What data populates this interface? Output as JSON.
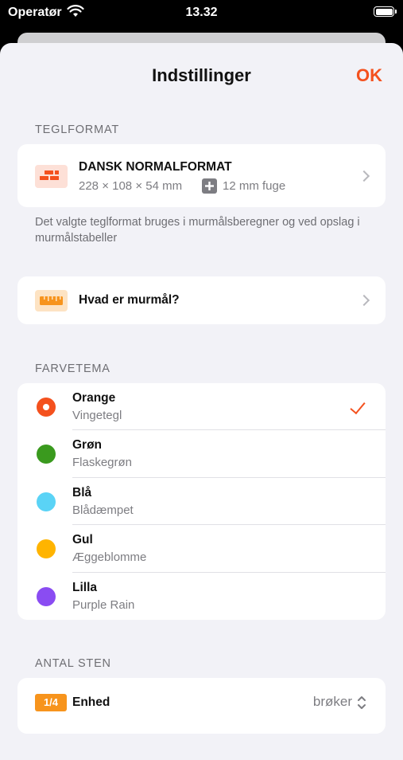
{
  "status_bar": {
    "carrier": "Operatør",
    "time": "13.32"
  },
  "nav": {
    "title": "Indstillinger",
    "ok_label": "OK"
  },
  "teglformat": {
    "header": "TEGLFORMAT",
    "title": "DANSK NORMALFORMAT",
    "dimensions": "228 × 108 × 54 mm",
    "joint": "12 mm fuge",
    "footer": "Det valgte teglformat bruges i murmålsberegner og ved opslag i murmålstabeller",
    "icon": "brick-icon"
  },
  "murmaal": {
    "label": "Hvad er murmål?",
    "icon": "ruler-icon"
  },
  "farvetema": {
    "header": "FARVETEMA",
    "items": [
      {
        "name": "Orange",
        "sub": "Vingetegl",
        "color": "#f4511e",
        "selected": true
      },
      {
        "name": "Grøn",
        "sub": "Flaskegrøn",
        "color": "#3a9a1e",
        "selected": false
      },
      {
        "name": "Blå",
        "sub": "Blådæmpet",
        "color": "#5ad3f6",
        "selected": false
      },
      {
        "name": "Gul",
        "sub": "Æggeblomme",
        "color": "#ffb400",
        "selected": false
      },
      {
        "name": "Lilla",
        "sub": "Purple Rain",
        "color": "#8a4cf2",
        "selected": false
      }
    ]
  },
  "antal_sten": {
    "header": "ANTAL STEN",
    "badge": "1/4",
    "label": "Enhed",
    "value": "brøker"
  },
  "colors": {
    "accent": "#f4511e",
    "background": "#f2f2f7"
  }
}
